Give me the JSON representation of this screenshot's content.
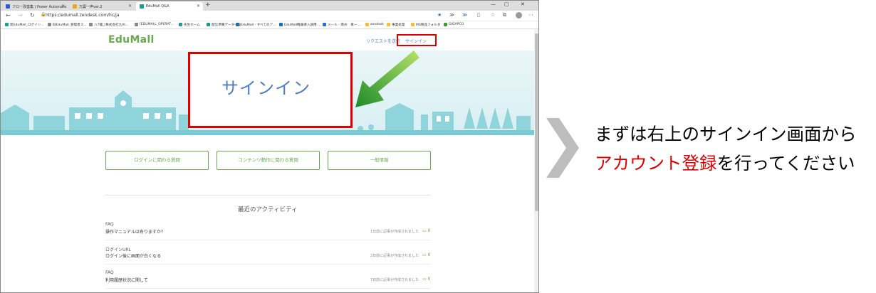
{
  "browser": {
    "tabs": [
      {
        "label": "フロー改善集 | Power Automate",
        "color": "#2d5fd1"
      },
      {
        "label": "万葉一声ver.2",
        "color": "#f1a51f"
      },
      {
        "label": "EduMall Q&A",
        "color": "#1a9f8a"
      }
    ],
    "new_tab": "+",
    "window_controls": [
      "—",
      "▢",
      "✕"
    ],
    "url": "https://edumall.zendesk.com/hc/ja",
    "bookmarks": [
      "新EduMall_ログイン...",
      "旧EduMall_管理者ス...",
      "八7閣_[株式会社九州...",
      "[EDUMALL_OPERAT...",
      "先生ホーム",
      "配信準備データ一覧",
      "EduMall - すべてのア...",
      "EduMall機器導入調用...",
      "メール - 南州　幸一 ...",
      "zendesk",
      "事業処理",
      "MS製品フォルダ",
      "GIGAPCO"
    ]
  },
  "page": {
    "logo": "EduMall",
    "request_link": "リクエストを送信",
    "signin_link": "サインイン",
    "popup_title": "サインイン",
    "category_buttons": [
      "ログインに関わる質問",
      "コンテンツ動作に関わる質問",
      "一般情報"
    ],
    "activity_title": "最近のアクティビティ",
    "activities": [
      {
        "category": "FAQ",
        "question": "操作マニュアルは有りますか？",
        "meta": "1日前に記事が作成されました",
        "comments": "0"
      },
      {
        "category": "ログインURL",
        "question": "ログイン後に画面が白くなる",
        "meta": "2日前に記事が作成されました",
        "comments": "0"
      },
      {
        "category": "FAQ",
        "question": "利用履歴状況に関して",
        "meta": "7日前に記事が作成されました",
        "comments": "0"
      }
    ]
  },
  "instruction": {
    "line1": "まずは右上のサインイン画面から",
    "line2_red": "アカウント登録",
    "line2_rest": "を行ってください"
  },
  "colors": {
    "brand_green": "#6aa84f",
    "highlight_red": "#e00000",
    "link_blue": "#4a7fc1",
    "hero_teal": "#7bcbd4"
  }
}
